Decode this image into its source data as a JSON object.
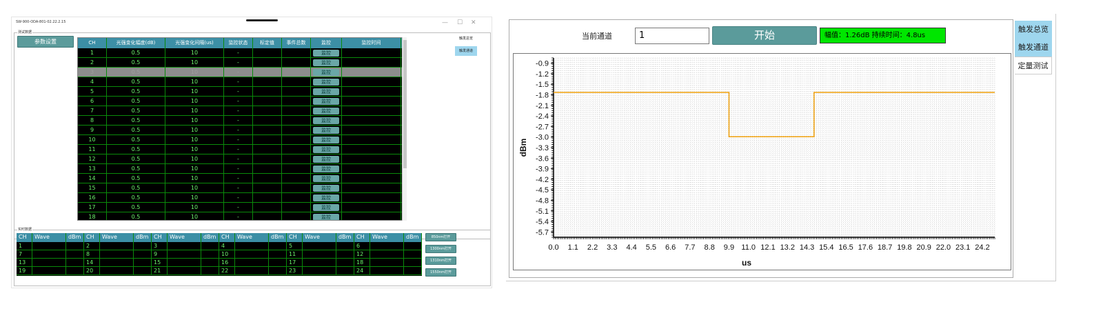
{
  "left_window": {
    "title": "SW-900-ODA-801-02.22.2.15",
    "window_buttons": [
      "—",
      "☐",
      "✕"
    ],
    "group_test": "测试数据",
    "param_button": "参数设置",
    "columns": [
      "CH",
      "光强变化幅度(dB)",
      "光强变化间隔(us)",
      "监控状态",
      "标定值",
      "事件总数",
      "监控",
      "监控时间"
    ],
    "rows": [
      [
        "1",
        "0.5",
        "10",
        "-",
        "",
        "",
        "监控",
        ""
      ],
      [
        "2",
        "0.5",
        "10",
        "-",
        "",
        "",
        "监控",
        ""
      ],
      [
        "3",
        "0.5",
        "10",
        "-",
        "",
        "",
        "监控",
        ""
      ],
      [
        "4",
        "0.5",
        "10",
        "-",
        "",
        "",
        "监控",
        ""
      ],
      [
        "5",
        "0.5",
        "10",
        "-",
        "",
        "",
        "监控",
        ""
      ],
      [
        "6",
        "0.5",
        "10",
        "-",
        "",
        "",
        "监控",
        ""
      ],
      [
        "7",
        "0.5",
        "10",
        "-",
        "",
        "",
        "监控",
        ""
      ],
      [
        "8",
        "0.5",
        "10",
        "-",
        "",
        "",
        "监控",
        ""
      ],
      [
        "9",
        "0.5",
        "10",
        "-",
        "",
        "",
        "监控",
        ""
      ],
      [
        "10",
        "0.5",
        "10",
        "-",
        "",
        "",
        "监控",
        ""
      ],
      [
        "11",
        "0.5",
        "10",
        "-",
        "",
        "",
        "监控",
        ""
      ],
      [
        "12",
        "0.5",
        "10",
        "-",
        "",
        "",
        "监控",
        ""
      ],
      [
        "13",
        "0.5",
        "10",
        "-",
        "",
        "",
        "监控",
        ""
      ],
      [
        "14",
        "0.5",
        "10",
        "-",
        "",
        "",
        "监控",
        ""
      ],
      [
        "15",
        "0.5",
        "10",
        "-",
        "",
        "",
        "监控",
        ""
      ],
      [
        "16",
        "0.5",
        "10",
        "-",
        "",
        "",
        "监控",
        ""
      ],
      [
        "17",
        "0.5",
        "10",
        "-",
        "",
        "",
        "监控",
        ""
      ],
      [
        "18",
        "0.5",
        "10",
        "-",
        "",
        "",
        "监控",
        ""
      ]
    ],
    "selected_row": 2,
    "side_tabs": [
      "触发总览",
      "触发通道"
    ],
    "group_realtime": "实时数据",
    "rt_columns": [
      "CH",
      "Wave",
      "dBm",
      "CH",
      "Wave",
      "dBm",
      "CH",
      "Wave",
      "dBm",
      "CH",
      "Wave",
      "dBm",
      "CH",
      "Wave",
      "dBm",
      "CH",
      "Wave",
      "dBm"
    ],
    "rt_rows": [
      [
        "1",
        "",
        "",
        "2",
        "",
        "",
        "3",
        "",
        "",
        "4",
        "",
        "",
        "5",
        "",
        "",
        "6",
        "",
        ""
      ],
      [
        "7",
        "",
        "",
        "8",
        "",
        "",
        "9",
        "",
        "",
        "10",
        "",
        "",
        "11",
        "",
        "",
        "12",
        "",
        ""
      ],
      [
        "13",
        "",
        "",
        "14",
        "",
        "",
        "15",
        "",
        "",
        "16",
        "",
        "",
        "17",
        "",
        "",
        "18",
        "",
        ""
      ],
      [
        "19",
        "",
        "",
        "20",
        "",
        "",
        "21",
        "",
        "",
        "22",
        "",
        "",
        "23",
        "",
        "",
        "24",
        "",
        ""
      ]
    ],
    "right_buttons": [
      "850nm打开",
      "1300nm打开",
      "1310nm打开",
      "1550nm打开"
    ]
  },
  "right_window": {
    "channel_label": "当前通道",
    "channel_value": "1",
    "start_button": "开始",
    "status_text": "幅值：1.26dB 持续时间：4.8us",
    "tabs": [
      "触发总览",
      "触发通道",
      "定量测试"
    ],
    "active_tab": 2
  },
  "chart_data": {
    "type": "line",
    "xlabel": "us",
    "ylabel": "dBm",
    "xlim": [
      0.0,
      24.9
    ],
    "ylim": [
      -5.85,
      -0.75
    ],
    "x_ticks": [
      "0.0",
      "1.1",
      "2.2",
      "3.3",
      "4.4",
      "5.5",
      "6.6",
      "7.7",
      "8.8",
      "9.9",
      "11.0",
      "12.1",
      "13.2",
      "14.3",
      "15.4",
      "16.5",
      "17.6",
      "18.7",
      "19.8",
      "20.9",
      "22.0",
      "23.1",
      "24.2"
    ],
    "y_ticks": [
      "-0.9",
      "-1.2",
      "-1.5",
      "-1.8",
      "-2.1",
      "-2.4",
      "-2.7",
      "-3.0",
      "-3.3",
      "-3.6",
      "-3.9",
      "-4.2",
      "-4.5",
      "-4.8",
      "-5.1",
      "-5.4",
      "-5.7"
    ],
    "grid": true,
    "series": [
      {
        "color": "#f2a20c",
        "x": [
          0.0,
          9.9,
          9.9,
          14.7,
          14.7,
          24.9
        ],
        "y": [
          -1.73,
          -1.73,
          -2.99,
          -2.99,
          -1.73,
          -1.73
        ]
      }
    ]
  }
}
